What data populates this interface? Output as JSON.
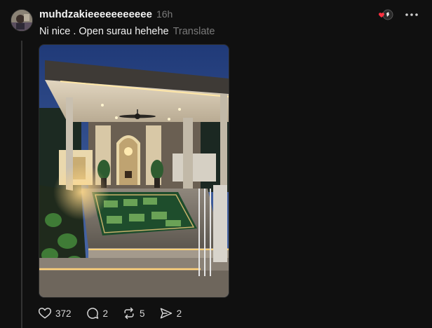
{
  "post": {
    "username": "muhdzakieeeeeeeeeee",
    "time": "16h",
    "text": "Ni nice . Open surau hehehe",
    "translate_label": "Translate",
    "image_alt": "Outdoor surau at night"
  },
  "actions": {
    "likes": "372",
    "replies": "2",
    "reposts": "5",
    "shares": "2"
  },
  "colors": {
    "background": "#101010",
    "secondary_text": "#7a7a7a",
    "like_red": "#ff3040"
  }
}
